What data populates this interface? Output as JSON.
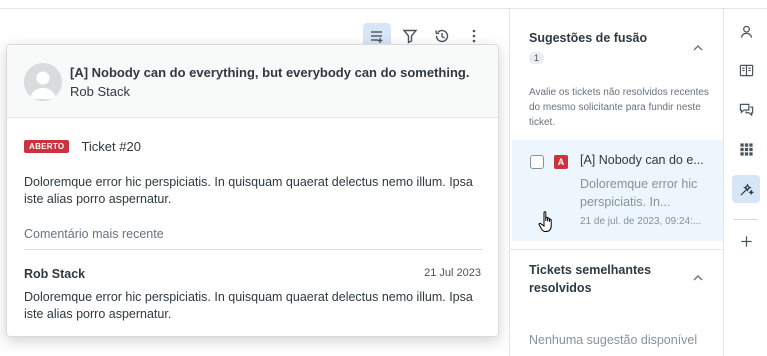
{
  "card": {
    "title": "[A] Nobody can do everything, but everybody can do something.",
    "author": "Rob Stack",
    "status_badge": "ABERTO",
    "ticket_number": "Ticket #20",
    "description": "Doloremque error hic perspiciatis. In quisquam quaerat delectus nemo illum. Ipsa iste alias porro aspernatur.",
    "recent_comment_label": "Comentário mais recente",
    "comment": {
      "author": "Rob Stack",
      "date": "21 Jul 2023",
      "body": "Doloremque error hic perspiciatis. In quisquam quaerat delectus nemo illum. Ipsa iste alias porro aspernatur."
    }
  },
  "side": {
    "merge_title": "Sugestões de fusão",
    "merge_count": "1",
    "merge_note": "Avalie os tickets não resolvidos recentes do mesmo solicitante para fundir neste ticket.",
    "suggestion": {
      "badge": "A",
      "title": "[A] Nobody can do e...",
      "desc": "Doloremque error hic perspiciatis. In...",
      "date": "21 de jul. de 2023, 09:24:..."
    },
    "similar_title": "Tickets semelhantes resolvidos",
    "empty_note": "Nenhuma sugestão disponível"
  },
  "toolbar": {
    "icons": [
      "list-add-icon",
      "filter-icon",
      "history-icon",
      "more-vertical-icon"
    ]
  },
  "rail": {
    "icons": [
      "user-icon",
      "book-icon",
      "chat-icon",
      "apps-grid-icon",
      "magic-wand-icon",
      "plus-icon"
    ]
  },
  "colors": {
    "accent_active": "#d7e6f7",
    "badge_red": "#cc3340",
    "suggest_bg": "#edf5fd"
  }
}
